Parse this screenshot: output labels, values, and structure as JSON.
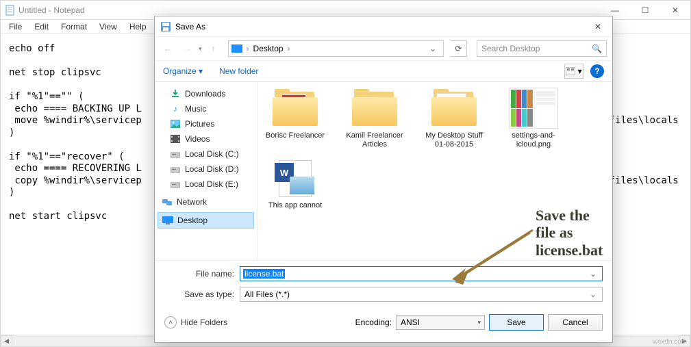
{
  "notepad": {
    "title": "Untitled - Notepad",
    "menus": [
      "File",
      "Edit",
      "Format",
      "View",
      "Help"
    ],
    "content": "echo off\n\nnet stop clipsvc\n\nif \"%1\"==\"\" (\n echo ==== BACKING UP L\n move %windir%\\servicep                                                                                 files\\locals\n)\n\nif \"%1\"==\"recover\" (\n echo ==== RECOVERING L\n copy %windir%\\servicep                                                                                 files\\locals\n)\n\nnet start clipsvc"
  },
  "dialog": {
    "title": "Save As",
    "breadcrumb_root": "Desktop",
    "search_placeholder": "Search Desktop",
    "organize": "Organize",
    "newfolder": "New folder",
    "tree": [
      {
        "icon": "download-icon",
        "label": "Downloads"
      },
      {
        "icon": "music-icon",
        "label": "Music"
      },
      {
        "icon": "pictures-icon",
        "label": "Pictures"
      },
      {
        "icon": "videos-icon",
        "label": "Videos"
      },
      {
        "icon": "disk-icon",
        "label": "Local Disk (C:)"
      },
      {
        "icon": "disk-icon",
        "label": "Local Disk (D:)"
      },
      {
        "icon": "disk-icon",
        "label": "Local Disk (E:)"
      },
      {
        "icon": "network-icon",
        "label": "Network"
      },
      {
        "icon": "desktop-icon",
        "label": "Desktop",
        "selected": true
      }
    ],
    "files": [
      {
        "type": "folder",
        "name": "Borisc Freelancer"
      },
      {
        "type": "folder",
        "name": "Kamil Freelancer Articles"
      },
      {
        "type": "folder",
        "name": "My Desktop Stuff 01-08-2015"
      },
      {
        "type": "image",
        "name": "settings-and-icloud.png"
      },
      {
        "type": "doc",
        "name": "This app cannot"
      }
    ],
    "filename_label": "File name:",
    "filename_value": "license.bat",
    "savetype_label": "Save as type:",
    "savetype_value": "All Files  (*.*)",
    "hide_folders": "Hide Folders",
    "encoding_label": "Encoding:",
    "encoding_value": "ANSI",
    "save": "Save",
    "cancel": "Cancel"
  },
  "annotation": "Save the file as license.bat",
  "watermark": "wsxdn.com"
}
